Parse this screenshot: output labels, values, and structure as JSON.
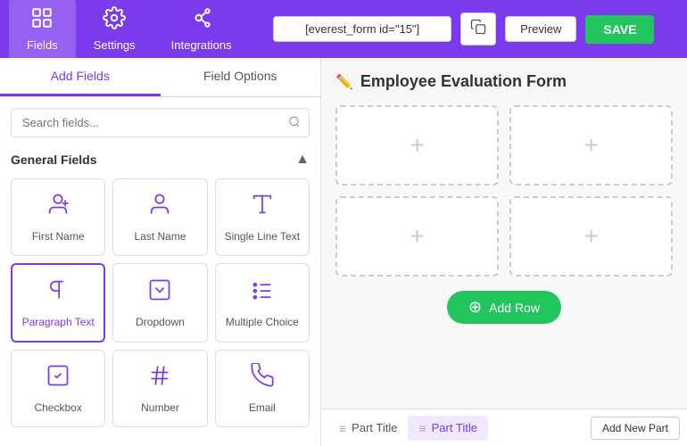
{
  "nav": {
    "items": [
      {
        "id": "fields",
        "label": "Fields",
        "icon": "fields",
        "active": true
      },
      {
        "id": "settings",
        "label": "Settings",
        "icon": "settings",
        "active": false
      },
      {
        "id": "integrations",
        "label": "Integrations",
        "icon": "integrations",
        "active": false
      }
    ],
    "shortcode": "[everest_form id=\"15\"]",
    "preview_label": "Preview",
    "save_label": "SAVE"
  },
  "left_panel": {
    "tabs": [
      {
        "id": "add-fields",
        "label": "Add Fields",
        "active": true
      },
      {
        "id": "field-options",
        "label": "Field Options",
        "active": false
      }
    ],
    "search": {
      "placeholder": "Search fields...",
      "value": ""
    },
    "section": {
      "title": "General Fields",
      "collapsed": false
    },
    "fields": [
      {
        "id": "first-name",
        "label": "First Name",
        "icon": "user-field",
        "selected": false
      },
      {
        "id": "last-name",
        "label": "Last Name",
        "icon": "user-field",
        "selected": false
      },
      {
        "id": "single-line-text",
        "label": "Single Line Text",
        "icon": "text-field",
        "selected": false
      },
      {
        "id": "paragraph-text",
        "label": "Paragraph Text",
        "icon": "paragraph-field",
        "selected": true
      },
      {
        "id": "dropdown",
        "label": "Dropdown",
        "icon": "dropdown-field",
        "selected": false
      },
      {
        "id": "multiple-choice",
        "label": "Multiple Choice",
        "icon": "multiple-choice-field",
        "selected": false
      },
      {
        "id": "checkbox",
        "label": "Checkbox",
        "icon": "checkbox-field",
        "selected": false
      },
      {
        "id": "number",
        "label": "Number",
        "icon": "number-field",
        "selected": false
      },
      {
        "id": "email",
        "label": "Email",
        "icon": "email-field",
        "selected": false
      }
    ]
  },
  "right_panel": {
    "form_title": "Employee Evaluation Form",
    "drop_zones": [
      [
        {
          "id": "dz1"
        },
        {
          "id": "dz2"
        }
      ],
      [
        {
          "id": "dz3"
        },
        {
          "id": "dz4"
        }
      ]
    ],
    "add_row_label": "Add Row",
    "parts": [
      {
        "id": "part1",
        "label": "Part Title",
        "active": false
      },
      {
        "id": "part2",
        "label": "Part Title",
        "active": true
      }
    ],
    "add_part_label": "Add New Part"
  }
}
